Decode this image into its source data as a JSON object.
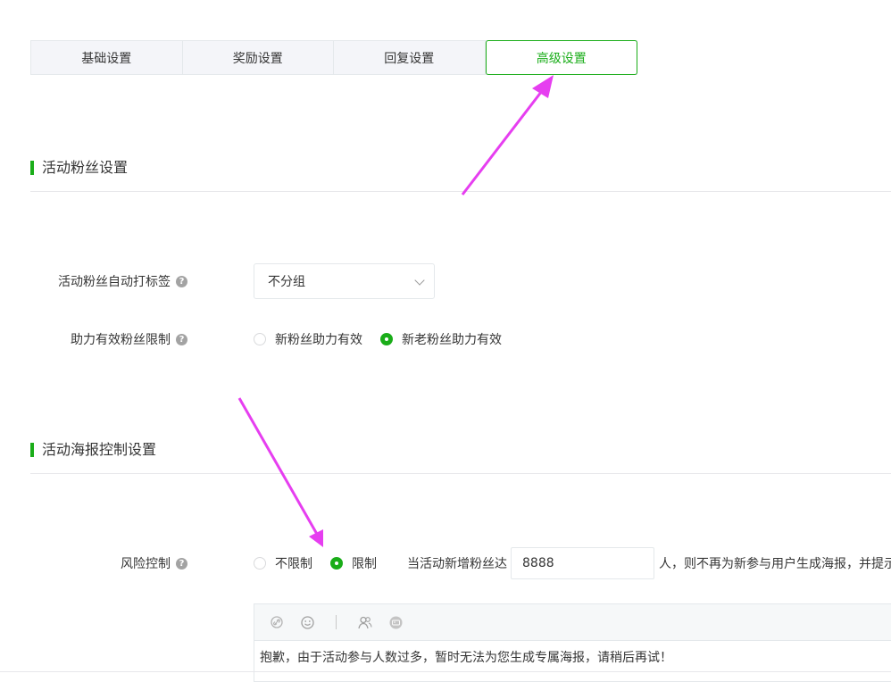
{
  "tabs": [
    {
      "label": "基础设置",
      "active": false
    },
    {
      "label": "奖励设置",
      "active": false
    },
    {
      "label": "回复设置",
      "active": false
    },
    {
      "label": "高级设置",
      "active": true
    }
  ],
  "section_fans": {
    "title": "活动粉丝设置",
    "auto_tag": {
      "label": "活动粉丝自动打标签",
      "help_icon": "question-icon",
      "selected": "不分组"
    },
    "assist_limit": {
      "label": "助力有效粉丝限制",
      "options": [
        {
          "label": "新粉丝助力有效",
          "checked": false
        },
        {
          "label": "新老粉丝助力有效",
          "checked": true
        }
      ]
    }
  },
  "section_poster": {
    "title": "活动海报控制设置",
    "risk": {
      "label": "风险控制",
      "options": [
        {
          "label": "不限制",
          "checked": false
        },
        {
          "label": "限制",
          "checked": true
        }
      ],
      "prefix": "当活动新增粉丝达",
      "value": "8888",
      "suffix": "人，则不再为新参与用户生成海报，并提示"
    },
    "editor": {
      "toolbar_icons": [
        "link-icon",
        "emoji-icon",
        "divider",
        "user-nickname-icon",
        "image-icon"
      ],
      "content": "抱歉，由于活动参与人数过多，暂时无法为您生成专属海报，请稍后再试！"
    }
  },
  "colors": {
    "accent": "#1aad19",
    "arrow": "#e63ef0"
  }
}
